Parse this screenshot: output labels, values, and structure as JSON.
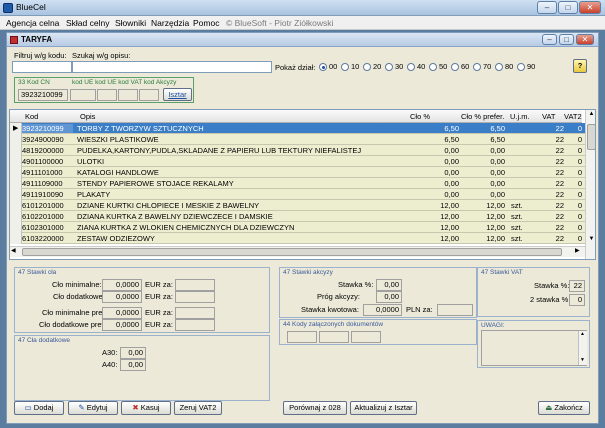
{
  "window": {
    "title": "BlueCel",
    "min": "–",
    "max": "□",
    "close": "✕"
  },
  "menu": {
    "items": [
      "Agencja celna",
      "Skład celny",
      "Słowniki",
      "Narzędzia",
      "Pomoc"
    ],
    "copyright": "© BlueSoft - Piotr Ziółkowski"
  },
  "inner": {
    "title": "TARYFA",
    "min": "–",
    "max": "□",
    "close": "✕"
  },
  "filter": {
    "kod_label": "Filtruj w/g kodu:",
    "opis_label": "Szukaj w/g opisu:",
    "pokaz_label": "Pokaż dział:",
    "radios": [
      "00",
      "10",
      "20",
      "30",
      "40",
      "50",
      "60",
      "70",
      "80",
      "90"
    ],
    "selected": "00"
  },
  "codes": {
    "title": "33 Kod CN",
    "ue_title": "kod UE kod UE kod VAT kod Akcyzy",
    "cn_value": "3923210099",
    "button": "Isztar"
  },
  "table": {
    "headers": [
      "Kod",
      "Opis",
      "Cło %",
      "Cło % prefer.",
      "U.j.m.",
      "VAT",
      "VAT2"
    ],
    "rows": [
      {
        "kod": "3923210099",
        "opis": "TORBY Z TWORZYW SZTUCZNYCH",
        "clo": "6,50",
        "pref": "6,50",
        "ujm": "",
        "vat": "22",
        "vat2": "0"
      },
      {
        "kod": "3924900090",
        "opis": "WIESZKI PLASTIKOWE",
        "clo": "6,50",
        "pref": "6,50",
        "ujm": "",
        "vat": "22",
        "vat2": "0"
      },
      {
        "kod": "4819200000",
        "opis": "PUDELKA,KARTONY,PUDLA,SKLADANE Z PAPIERU LUB TEKTURY NIEFALISTEJ",
        "clo": "0,00",
        "pref": "0,00",
        "ujm": "",
        "vat": "22",
        "vat2": "0"
      },
      {
        "kod": "4901100000",
        "opis": "ULOTKI",
        "clo": "0,00",
        "pref": "0,00",
        "ujm": "",
        "vat": "22",
        "vat2": "0"
      },
      {
        "kod": "4911101000",
        "opis": "KATALOGI HANDLOWE",
        "clo": "0,00",
        "pref": "0,00",
        "ujm": "",
        "vat": "22",
        "vat2": "0"
      },
      {
        "kod": "4911109000",
        "opis": "STENDY PAPIEROWE STOJACE REKALAMY",
        "clo": "0,00",
        "pref": "0,00",
        "ujm": "",
        "vat": "22",
        "vat2": "0"
      },
      {
        "kod": "4911910090",
        "opis": "PLAKATY",
        "clo": "0,00",
        "pref": "0,00",
        "ujm": "",
        "vat": "22",
        "vat2": "0"
      },
      {
        "kod": "6101201000",
        "opis": "DZIANE KURTKI CHLOPIECE I MESKIE Z BAWELNY",
        "clo": "12,00",
        "pref": "12,00",
        "ujm": "szt.",
        "vat": "22",
        "vat2": "0"
      },
      {
        "kod": "6102201000",
        "opis": "DZIANA KURTKA Z BAWELNY DZIEWCZECE I DAMSKIE",
        "clo": "12,00",
        "pref": "12,00",
        "ujm": "szt.",
        "vat": "22",
        "vat2": "0"
      },
      {
        "kod": "6102301000",
        "opis": "ZIANA KURTKA Z WLOKIEN CHEMICZNYCH DLA DZIEWCZYN",
        "clo": "12,00",
        "pref": "12,00",
        "ujm": "szt.",
        "vat": "22",
        "vat2": "0"
      },
      {
        "kod": "6103220000",
        "opis": "ZESTAW ODZIEZOWY",
        "clo": "12,00",
        "pref": "12,00",
        "ujm": "szt.",
        "vat": "22",
        "vat2": "0"
      }
    ]
  },
  "stawki_cla": {
    "title": "47 Stawki cła",
    "clo_min": "Cło minimalne:",
    "clo_dod": "Cło dodatkowe:",
    "clo_min_pref": "Cło minimalne pref:",
    "clo_dod_pref": "Cło dodatkowe pref:",
    "v1": "0,0000",
    "v2": "0,0000",
    "v3": "0,0000",
    "v4": "0,0000",
    "eur": "EUR za:"
  },
  "cla_dod": {
    "title": "47 Cła dodatkowe",
    "a30": "A30:",
    "a40": "A40:",
    "v30": "0,00",
    "v40": "0,00"
  },
  "akcyza": {
    "title": "47 Stawki akcyzy",
    "stawka": "Stawka %:",
    "prog": "Próg akcyzy:",
    "kwotowa": "Stawka kwotowa:",
    "v1": "0,00",
    "v2": "0,00",
    "v3": "0,0000",
    "pln": "PLN za:"
  },
  "dokumenty": {
    "title": "44 Kody załączonych dokumentów"
  },
  "vat": {
    "title": "47 Stawki VAT",
    "stawka": "Stawka %:",
    "stawka2": "2 stawka %:",
    "v1": "22",
    "v2": "0"
  },
  "uwagi": {
    "title": "UWAGI:"
  },
  "buttons": {
    "dodaj": "Dodaj",
    "edytuj": "Edytuj",
    "kasuj": "Kasuj",
    "zeruj": "Zeruj VAT2",
    "porownaj": "Porównaj z 028",
    "aktualizuj": "Aktualizuj z Isztar",
    "zakoncz": "Zakończ"
  }
}
